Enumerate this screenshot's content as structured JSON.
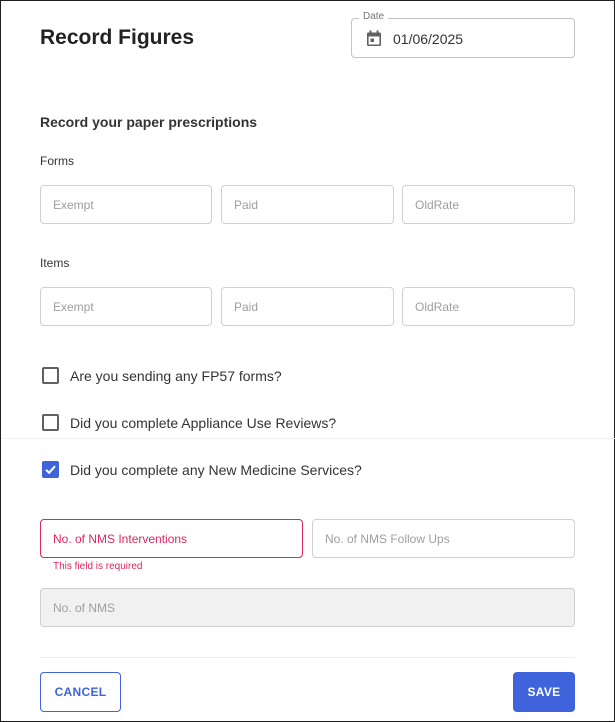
{
  "header": {
    "title": "Record Figures",
    "date_label": "Date",
    "date_value": "01/06/2025",
    "date_icon": "calendar-icon"
  },
  "section": {
    "subtitle": "Record your paper prescriptions"
  },
  "forms": {
    "label": "Forms",
    "exempt_placeholder": "Exempt",
    "paid_placeholder": "Paid",
    "oldrate_placeholder": "OldRate"
  },
  "items": {
    "label": "Items",
    "exempt_placeholder": "Exempt",
    "paid_placeholder": "Paid",
    "oldrate_placeholder": "OldRate"
  },
  "checks": [
    {
      "label": "Are you sending any FP57 forms?",
      "checked": false
    },
    {
      "label": "Did you complete Appliance Use Reviews?",
      "checked": false
    },
    {
      "label": "Did you complete any New Medicine Services?",
      "checked": true
    }
  ],
  "nms": {
    "interventions_placeholder": "No. of NMS Interventions",
    "interventions_error": "This field is required",
    "followups_placeholder": "No. of NMS Follow Ups",
    "total_placeholder": "No. of NMS"
  },
  "footer": {
    "cancel_label": "CANCEL",
    "save_label": "SAVE"
  },
  "colors": {
    "primary": "#3f63db",
    "error": "#e0245e"
  }
}
